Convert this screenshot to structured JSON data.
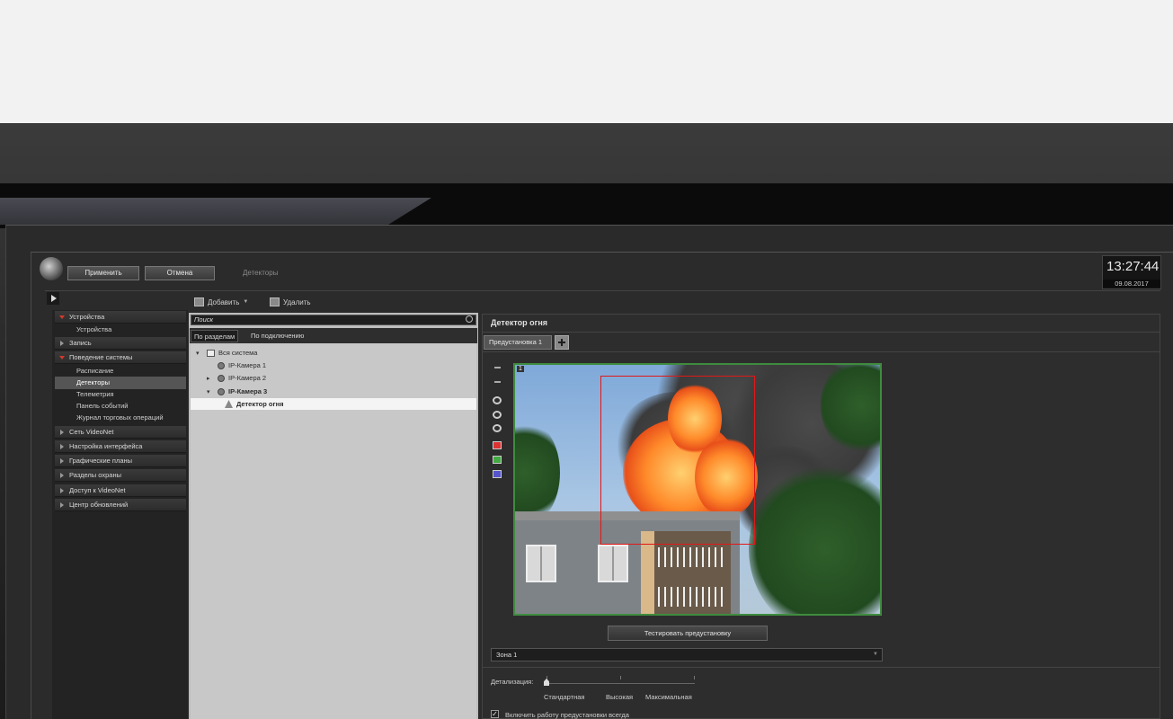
{
  "topbar": {
    "apply_label": "Применить",
    "cancel_label": "Отмена",
    "section_title": "Детекторы",
    "time": "13:27:44",
    "date": "09.08.2017"
  },
  "toolbar": {
    "add_label": "Добавить",
    "delete_label": "Удалить"
  },
  "sidebar": {
    "items": [
      {
        "label": "Устройства",
        "type": "section-open"
      },
      {
        "label": "Устройства",
        "type": "item"
      },
      {
        "label": "Запись",
        "type": "section"
      },
      {
        "label": "Поведение системы",
        "type": "section-open"
      },
      {
        "label": "Расписание",
        "type": "item"
      },
      {
        "label": "Детекторы",
        "type": "item-selected"
      },
      {
        "label": "Телеметрия",
        "type": "item"
      },
      {
        "label": "Панель событий",
        "type": "item"
      },
      {
        "label": "Журнал торговых операций",
        "type": "item"
      },
      {
        "label": "Сеть VideoNet",
        "type": "section"
      },
      {
        "label": "Настройка интерфейса",
        "type": "section"
      },
      {
        "label": "Графические планы",
        "type": "section"
      },
      {
        "label": "Разделы охраны",
        "type": "section"
      },
      {
        "label": "Доступ к VideoNet",
        "type": "section"
      },
      {
        "label": "Центр обновлений",
        "type": "section"
      }
    ]
  },
  "tree": {
    "search_placeholder": "Поиск",
    "tabs": [
      {
        "label": "По разделам",
        "active": true
      },
      {
        "label": "По подключению",
        "active": false
      }
    ],
    "nodes": [
      {
        "label": "Вся система"
      },
      {
        "label": "IP-Камера 1"
      },
      {
        "label": "IP-Камера 2"
      },
      {
        "label": "IP-Камера 3"
      },
      {
        "label": "Детектор огня",
        "selected": true
      }
    ]
  },
  "detector": {
    "title": "Детектор огня",
    "preset_tab": "Предустановка 1",
    "video_number": "1",
    "test_button": "Тестировать предустановку",
    "zone": "Зона 1",
    "detail_label": "Детализация:",
    "detail_levels": [
      "Стандартная",
      "Высокая",
      "Максимальная"
    ],
    "detail_level_selected": 0,
    "always_on_checked": true,
    "always_on_label": "Включить работу предустановки всегда"
  },
  "colors": {
    "accent_red": "#d23a2a",
    "detection_box": "#e01818",
    "video_border": "#3f8c3f"
  }
}
